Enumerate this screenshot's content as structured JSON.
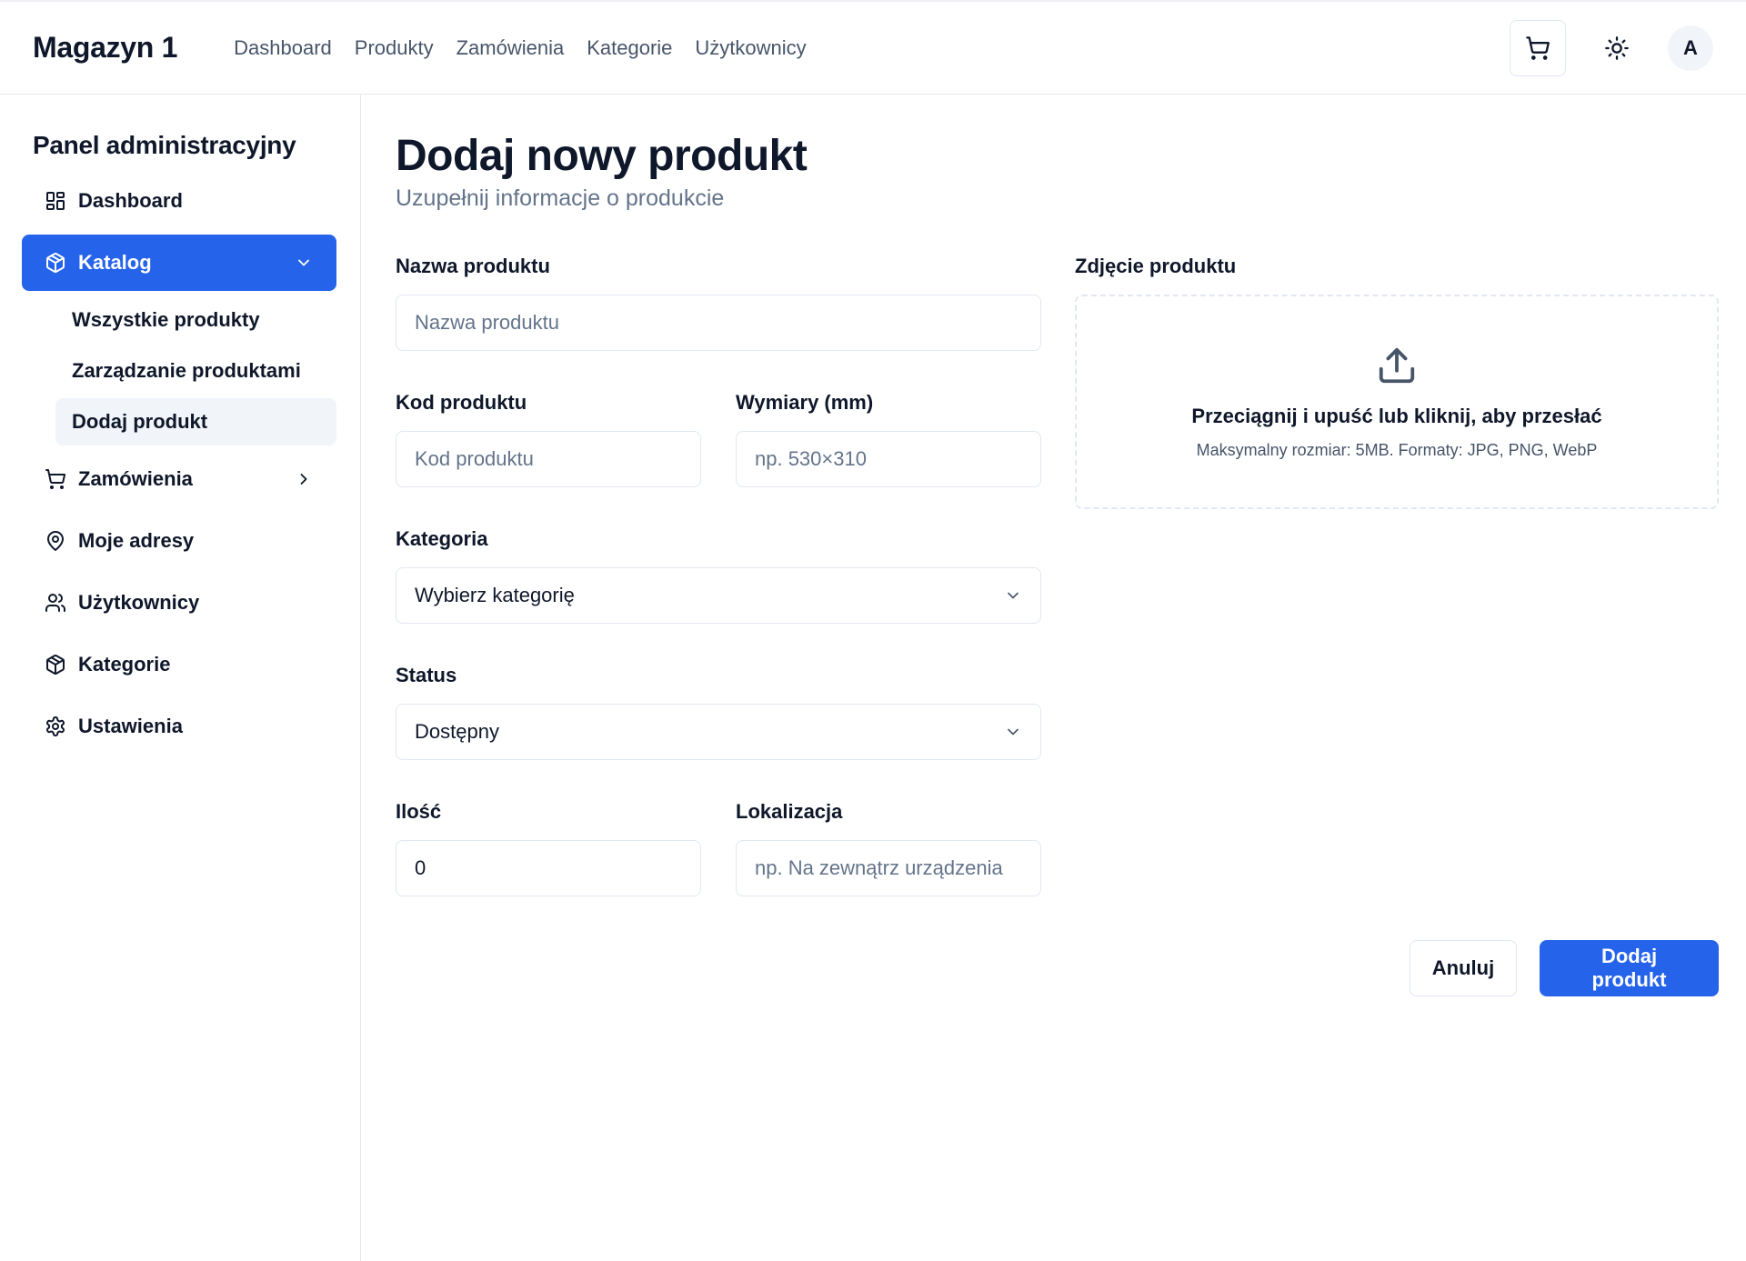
{
  "header": {
    "brand": "Magazyn 1",
    "nav": [
      "Dashboard",
      "Produkty",
      "Zamówienia",
      "Kategorie",
      "Użytkownicy"
    ],
    "avatar_initial": "A",
    "icons": [
      "cart-icon",
      "sun-icon"
    ]
  },
  "sidebar": {
    "title": "Panel administracyjny",
    "items": [
      {
        "label": "Dashboard",
        "icon": "dashboard-grid-icon"
      },
      {
        "label": "Katalog",
        "icon": "package-icon",
        "active": true,
        "expanded": true
      },
      {
        "label": "Zamówienia",
        "icon": "cart-icon"
      },
      {
        "label": "Moje adresy",
        "icon": "map-pin-icon"
      },
      {
        "label": "Użytkownicy",
        "icon": "users-icon"
      },
      {
        "label": "Kategorie",
        "icon": "package-icon"
      },
      {
        "label": "Ustawienia",
        "icon": "gear-icon"
      }
    ],
    "catalog_sub": [
      "Wszystkie produkty",
      "Zarządzanie produktami",
      "Dodaj produkt"
    ],
    "accent": "#2563eb"
  },
  "main": {
    "title": "Dodaj nowy produkt",
    "subtitle": "Uzupełnij informacje o produkcie",
    "form": {
      "name": {
        "label": "Nazwa produktu",
        "placeholder": "Nazwa produktu",
        "value": ""
      },
      "code": {
        "label": "Kod produktu",
        "placeholder": "Kod produktu",
        "value": ""
      },
      "dims": {
        "label": "Wymiary (mm)",
        "placeholder": "np. 530×310",
        "value": ""
      },
      "category": {
        "label": "Kategoria",
        "value": "Wybierz kategorię"
      },
      "status": {
        "label": "Status",
        "value": "Dostępny"
      },
      "qty": {
        "label": "Ilość",
        "value": "0"
      },
      "location": {
        "label": "Lokalizacja",
        "placeholder": "np. Na zewnątrz urządzenia",
        "value": ""
      }
    },
    "upload": {
      "label": "Zdjęcie produktu",
      "title": "Przeciągnij i upuść lub kliknij, aby przesłać",
      "hint": "Maksymalny rozmiar: 5MB. Formaty: JPG, PNG, WebP"
    },
    "actions": {
      "cancel": "Anuluj",
      "submit": "Dodaj produkt"
    }
  }
}
